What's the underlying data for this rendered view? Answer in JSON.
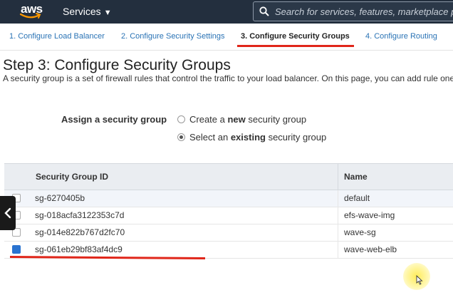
{
  "nav": {
    "logo": "aws",
    "services_label": "Services",
    "search_placeholder": "Search for services, features, marketplace pro"
  },
  "steps": [
    {
      "label": "1. Configure Load Balancer",
      "active": false
    },
    {
      "label": "2. Configure Security Settings",
      "active": false
    },
    {
      "label": "3. Configure Security Groups",
      "active": true
    },
    {
      "label": "4. Configure Routing",
      "active": false
    }
  ],
  "page": {
    "title": "Step 3: Configure Security Groups",
    "description": "A security group is a set of firewall rules that control the traffic to your load balancer. On this page, you can add rule one."
  },
  "assign": {
    "label": "Assign a security group",
    "option_new": {
      "pre": "Create a ",
      "bold": "new",
      "post": " security group",
      "selected": false
    },
    "option_existing": {
      "pre": "Select an ",
      "bold": "existing",
      "post": " security group",
      "selected": true
    }
  },
  "table": {
    "headers": {
      "id": "Security Group ID",
      "name": "Name"
    },
    "rows": [
      {
        "id": "sg-6270405b",
        "name": "default",
        "checked": false
      },
      {
        "id": "sg-018acfa3122353c7d",
        "name": "efs-wave-img",
        "checked": false
      },
      {
        "id": "sg-014e822b767d2fc70",
        "name": "wave-sg",
        "checked": false
      },
      {
        "id": "sg-061eb29bf83af4dc9",
        "name": "wave-web-elb",
        "checked": true
      }
    ]
  },
  "colors": {
    "nav_bg": "#232f3e",
    "link": "#2a73b5",
    "annotation_red": "#e0261a",
    "checkbox_selected": "#2a73d0"
  },
  "icons": {
    "search": "search-icon",
    "services_caret": "caret-down-icon",
    "back": "chevron-left-icon",
    "cursor": "mouse-pointer-icon"
  }
}
